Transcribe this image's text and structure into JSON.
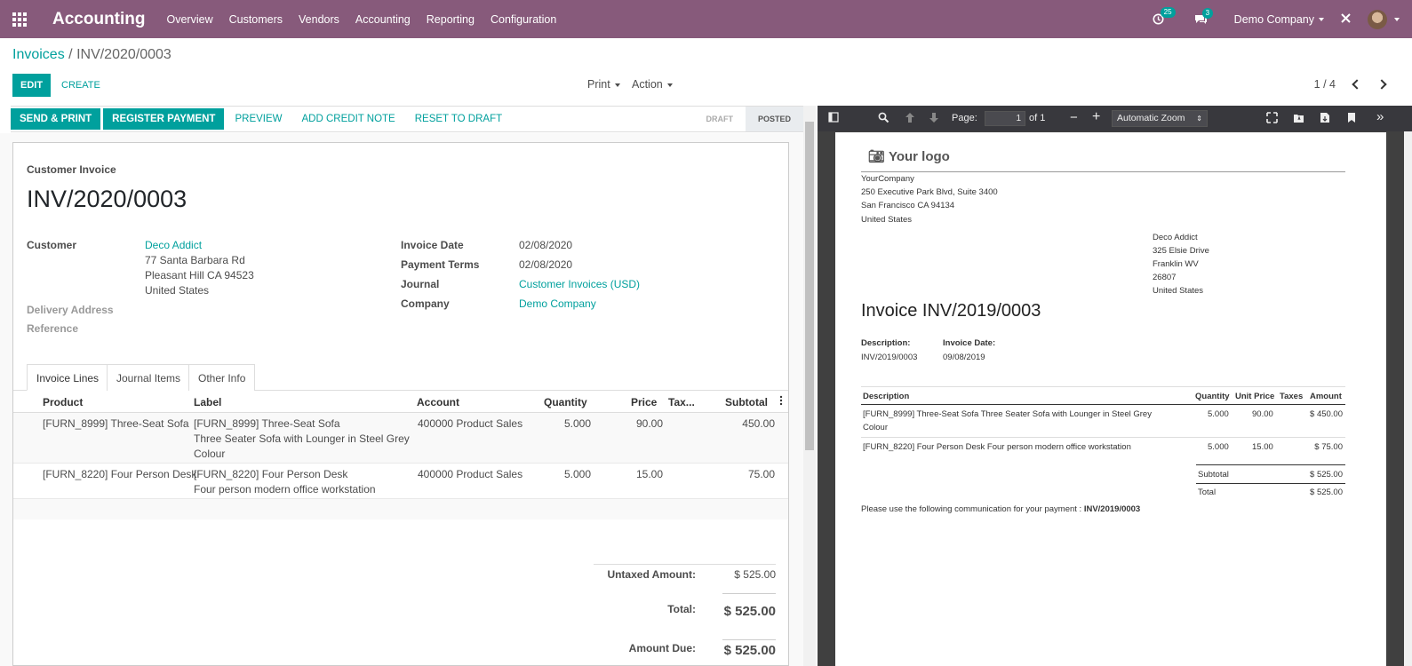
{
  "app": {
    "name": "Accounting",
    "menu": [
      "Overview",
      "Customers",
      "Vendors",
      "Accounting",
      "Reporting",
      "Configuration"
    ],
    "activity_badge": "25",
    "messages_badge": "3",
    "company": "Demo Company"
  },
  "breadcrumb": {
    "parent": "Invoices",
    "separator": "/",
    "current": "INV/2020/0003"
  },
  "control": {
    "edit": "EDIT",
    "create": "CREATE",
    "print": "Print",
    "action": "Action",
    "pager": "1 / 4"
  },
  "statusbar": {
    "buttons": [
      "SEND & PRINT",
      "REGISTER PAYMENT",
      "PREVIEW",
      "ADD CREDIT NOTE",
      "RESET TO DRAFT"
    ],
    "steps": [
      "DRAFT",
      "POSTED"
    ],
    "active_step": "POSTED"
  },
  "form": {
    "type_label": "Customer Invoice",
    "name": "INV/2020/0003",
    "customer_label": "Customer",
    "customer_name": "Deco Addict",
    "customer_addr1": "77 Santa Barbara Rd",
    "customer_addr2": "Pleasant Hill CA 94523",
    "customer_addr3": "United States",
    "delivery_label": "Delivery Address",
    "reference_label": "Reference",
    "invoice_date_label": "Invoice Date",
    "invoice_date": "02/08/2020",
    "payment_terms_label": "Payment Terms",
    "payment_terms": "02/08/2020",
    "journal_label": "Journal",
    "journal": "Customer Invoices (USD)",
    "company_label": "Company",
    "company": "Demo Company"
  },
  "tabs": [
    "Invoice Lines",
    "Journal Items",
    "Other Info"
  ],
  "lines": {
    "headers": [
      "Product",
      "Label",
      "Account",
      "Quantity",
      "Price",
      "Tax...",
      "Subtotal"
    ],
    "rows": [
      {
        "product": "[FURN_8999] Three-Seat Sofa",
        "label1": "[FURN_8999] Three-Seat Sofa",
        "label2": "Three Seater Sofa with Lounger in Steel Grey",
        "label3": "Colour",
        "account": "400000 Product Sales",
        "quantity": "5.000",
        "price": "90.00",
        "subtotal": "450.00"
      },
      {
        "product": "[FURN_8220] Four Person Desk",
        "label1": "[FURN_8220] Four Person Desk",
        "label2": "Four person modern office workstation",
        "label3": "",
        "account": "400000 Product Sales",
        "quantity": "5.000",
        "price": "15.00",
        "subtotal": "75.00"
      }
    ]
  },
  "totals": {
    "untaxed_label": "Untaxed Amount:",
    "untaxed": "$ 525.00",
    "total_label": "Total:",
    "total": "$ 525.00",
    "due_label": "Amount Due:",
    "due": "$ 525.00"
  },
  "pdf": {
    "page_label": "Page:",
    "page_value": "1",
    "page_of": "of 1",
    "zoom": "Automatic Zoom",
    "logo": "Your logo",
    "company_lines": [
      "YourCompany",
      "250 Executive Park Blvd, Suite 3400",
      "San Francisco CA 94134",
      "United States"
    ],
    "partner_lines": [
      "Deco Addict",
      "325 Elsie Drive",
      "Franklin WV",
      "26807",
      "United States"
    ],
    "title": "Invoice INV/2019/0003",
    "desc_label": "Description:",
    "desc_value": "INV/2019/0003",
    "date_label": "Invoice Date:",
    "date_value": "09/08/2019",
    "table_headers": [
      "Description",
      "Quantity",
      "Unit Price",
      "Taxes",
      "Amount"
    ],
    "row1_desc1": "[FURN_8999] Three-Seat Sofa Three Seater Sofa with Lounger in Steel Grey",
    "row1_desc2": "Colour",
    "row1_qty": "5.000",
    "row1_price": "90.00",
    "row1_amount": "$ 450.00",
    "row2_desc": "[FURN_8220] Four Person Desk Four person modern office workstation",
    "row2_qty": "5.000",
    "row2_price": "15.00",
    "row2_amount": "$ 75.00",
    "subtotal_label": "Subtotal",
    "subtotal": "$ 525.00",
    "total_label": "Total",
    "total": "$ 525.00",
    "communication": "Please use the following communication for your payment :",
    "communication_ref": "INV/2019/0003"
  }
}
